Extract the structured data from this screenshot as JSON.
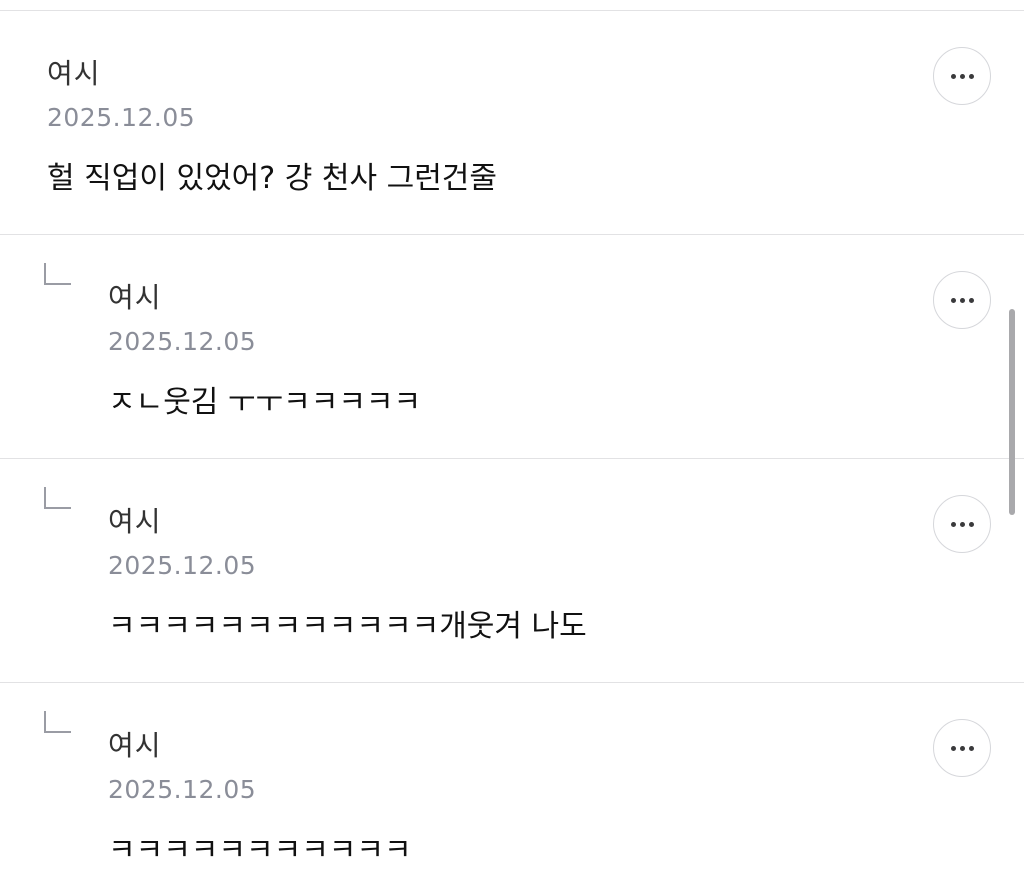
{
  "comments": [
    {
      "author": "여시",
      "date": "2025.12.05",
      "text": "헐 직업이 있었어? 걍 천사 그런건줄",
      "more_icon": "more-horizontal-icon"
    },
    {
      "author": "여시",
      "date": "2025.12.05",
      "text": "ㅈㄴ웃김 ㅜㅜㅋㅋㅋㅋㅋ",
      "more_icon": "more-horizontal-icon",
      "reply_icon": "reply-arrow-icon"
    },
    {
      "author": "여시",
      "date": "2025.12.05",
      "text": "ㅋㅋㅋㅋㅋㅋㅋㅋㅋㅋㅋㅋ개웃겨 나도",
      "more_icon": "more-horizontal-icon",
      "reply_icon": "reply-arrow-icon"
    },
    {
      "author": "여시",
      "date": "2025.12.05",
      "text": "ㅋㅋㅋㅋㅋㅋㅋㅋㅋㅋㅋ",
      "more_icon": "more-horizontal-icon",
      "reply_icon": "reply-arrow-icon"
    }
  ],
  "colors": {
    "divider": "#e2e2e4",
    "date": "#8a8d98",
    "text": "#111111",
    "scrollbar": "#a9a9ac"
  }
}
